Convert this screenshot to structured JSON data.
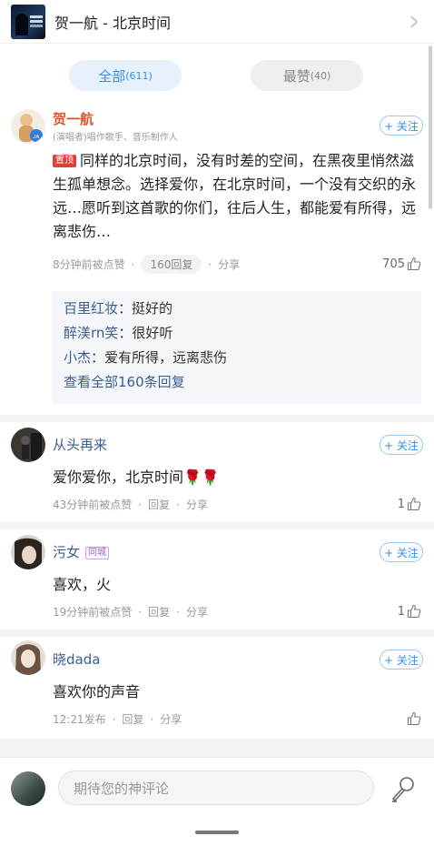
{
  "header": {
    "title": "贺一航 - 北京时间"
  },
  "tabs": [
    {
      "label": "全部",
      "count": "(611)"
    },
    {
      "label": "最赞",
      "count": "(40)"
    }
  ],
  "comments": [
    {
      "name": "贺一航",
      "subtitle": "(演唱者)唱作歌手、音乐制作人",
      "follow": "+ 关注",
      "pin": "置顶",
      "text": "同样的北京时间，没有时差的空间，在黑夜里悄然滋生孤单想念。选择爱你，在北京时间，一个没有交织的永远…愿听到这首歌的你们，往后人生，都能爱有所得，远离悲伤…",
      "time": "8分钟前被点赞",
      "reply": "160回复",
      "share": "分享",
      "likes": "705",
      "replies": [
        {
          "name": "百里红妆",
          "text": "：挺好的"
        },
        {
          "name": "醉渼rn笑",
          "text": "：很好听"
        },
        {
          "name": "小杰",
          "text": "：爱有所得，远离悲伤"
        }
      ],
      "more_replies": "查看全部160条回复"
    },
    {
      "name": "从头再来",
      "follow": "+ 关注",
      "text": "爱你爱你，北京时间🌹🌹",
      "time": "43分钟前被点赞",
      "reply": "回复",
      "share": "分享",
      "likes": "1"
    },
    {
      "name": "污女",
      "tag": "同城",
      "follow": "+ 关注",
      "text": "喜欢，火",
      "time": "19分钟前被点赞",
      "reply": "回复",
      "share": "分享",
      "likes": "1"
    },
    {
      "name": "晓dada",
      "follow": "+ 关注",
      "text": "喜欢你的声音",
      "time": "12:21发布",
      "reply": "回复",
      "share": "分享",
      "likes": ""
    }
  ],
  "input": {
    "placeholder": "期待您的神评论"
  },
  "colors": {
    "accent": "#3a8ee6",
    "hot_name": "#e0552b",
    "pin": "#e0403a"
  }
}
